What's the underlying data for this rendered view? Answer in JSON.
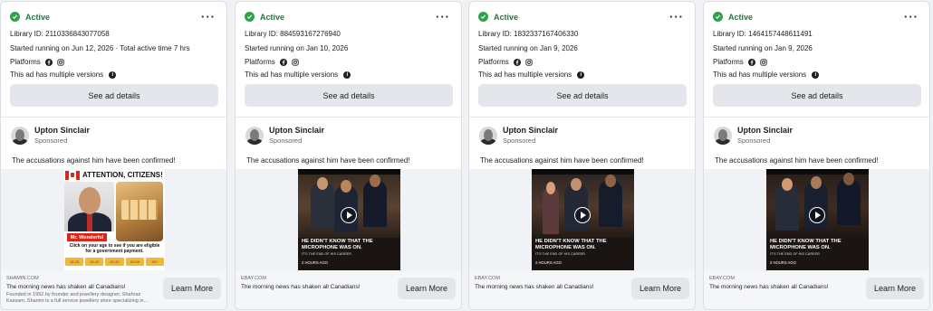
{
  "colors": {
    "active": "#31a24c",
    "page_bg": "#f0f2f5",
    "button_bg": "#e4e6eb"
  },
  "labels": {
    "status": "Active",
    "platforms": "Platforms",
    "multiple_versions": "This ad has multiple versions",
    "see_details": "See ad details",
    "sponsored": "Sponsored",
    "learn_more": "Learn More"
  },
  "cards": [
    {
      "library_id": "Library ID: 2110336843077058",
      "started": "Started running on Jun 12, 2026 · Total active time 7 hrs",
      "advertiser": "Upton Sinclair",
      "body_text": "The accusations against him have been confirmed!",
      "media_type": "image",
      "image": {
        "title": "ATTENTION, CITIZENS!",
        "badge": "Mr. Wonderful",
        "cta": "Click on your age to see if you are eligible for a government payment.",
        "ages": [
          "18-29",
          "30-39",
          "40-49",
          "50-59",
          "60+"
        ]
      },
      "domain": "SHAMIN.COM",
      "headline": "The morning news has shaken all Canadians!",
      "description": "Founded in 1992 by founder and jewellery designer, Shahraz Kassam, Shamin is a full service jewellery store specializing in..."
    },
    {
      "library_id": "Library ID: 884593167276940",
      "started": "Started running on Jan 10, 2026",
      "advertiser": "Upton Sinclair",
      "body_text": "The accusations against him have been confirmed!",
      "media_type": "video",
      "video": {
        "caption": "HE DIDN'T KNOW THAT THE MICROPHONE WAS ON.",
        "subcaption": "IT'S THE END OF HIS CAREER",
        "time": "2 HOURS AGO"
      },
      "domain": "EBAY.COM",
      "headline": "The morning news has shaken all Canadians!",
      "description": ""
    },
    {
      "library_id": "Library ID: 1832337167406330",
      "started": "Started running on Jan 9, 2026",
      "advertiser": "Upton Sinclair",
      "body_text": "The accusations against him have been confirmed!",
      "media_type": "video",
      "video": {
        "caption": "HE DIDN'T KNOW THAT THE MICROPHONE WAS ON.",
        "subcaption": "IT'S THE END OF HIS CAREER",
        "time": "2 HOURS AGO"
      },
      "domain": "EBAY.COM",
      "headline": "The morning news has shaken all Canadians!",
      "description": ""
    },
    {
      "library_id": "Library ID: 1464157448611491",
      "started": "Started running on Jan 9, 2026",
      "advertiser": "Upton Sinclair",
      "body_text": "The accusations against him have been confirmed!",
      "media_type": "video",
      "video": {
        "caption": "HE DIDN'T KNOW THAT THE MICROPHONE WAS ON.",
        "subcaption": "IT'S THE END OF HIS CAREER",
        "time": "2 HOURS AGO"
      },
      "domain": "EBAY.COM",
      "headline": "The morning news has shaken all Canadians!",
      "description": ""
    }
  ],
  "icons": [
    "check-icon",
    "more-options-icon",
    "facebook-icon",
    "instagram-icon",
    "info-icon",
    "play-icon"
  ]
}
